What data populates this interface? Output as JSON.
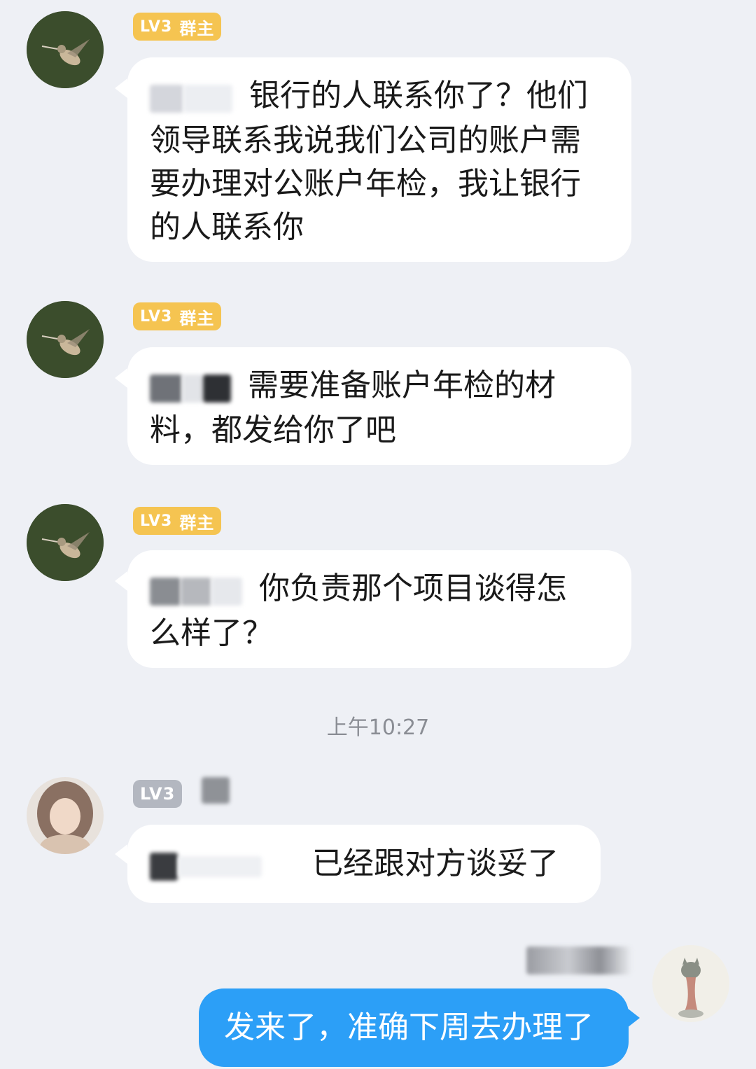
{
  "colors": {
    "background": "#eef0f5",
    "owner_badge": "#f5c451",
    "member_badge": "#b3b7c0",
    "self_bubble": "#2c9ff7",
    "other_bubble": "#ffffff"
  },
  "messages": [
    {
      "sender_level": "LV3",
      "sender_role": "群主",
      "avatar_icon": "hummingbird-avatar-icon",
      "text_line1": "银行的人联系你了？他们",
      "text_rest": "领导联系我说我们公司的账户需要办理对公账户年检，我让银行的人联系你"
    },
    {
      "sender_level": "LV3",
      "sender_role": "群主",
      "avatar_icon": "hummingbird-avatar-icon",
      "text_line1": "需要准备账户年检的材",
      "text_rest": "料，都发给你了吧"
    },
    {
      "sender_level": "LV3",
      "sender_role": "群主",
      "avatar_icon": "hummingbird-avatar-icon",
      "text_line1": "你负责那个项目谈得怎",
      "text_rest": "么样了？"
    }
  ],
  "timestamp": "上午10:27",
  "reply": {
    "sender_level": "LV3",
    "avatar_icon": "girl-avatar-icon",
    "text": "已经跟对方谈妥了"
  },
  "self_message": {
    "avatar_icon": "cat-avatar-icon",
    "text": "发来了，准确下周去办理了"
  }
}
